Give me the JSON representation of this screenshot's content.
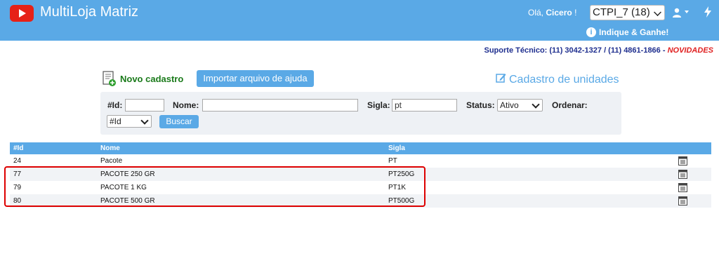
{
  "header": {
    "app_title": "MultiLoja Matriz",
    "greeting": "Olá,",
    "user_name": "Cicero",
    "greeting_suffix": "!",
    "store_select": "CTPI_7 (18)",
    "indique_label": "Indique & Ganhe!",
    "brand_color": "#5aa9e6",
    "logo_color": "#e62117"
  },
  "support": {
    "text": "Suporte Técnico: (11) 3042-1327 / (11) 4861-1866 -",
    "novidades": "NOVIDADES"
  },
  "actions": {
    "novo_cadastro": "Novo cadastro",
    "importar_label": "Importar arquivo de ajuda",
    "page_title": "Cadastro de unidades"
  },
  "filters": {
    "id_label": "#Id:",
    "id_value": "",
    "nome_label": "Nome:",
    "nome_value": "",
    "sigla_label": "Sigla:",
    "sigla_value": "pt",
    "status_label": "Status:",
    "status_value": "Ativo",
    "ordenar_label": "Ordenar:",
    "ordenar_value": "#Id",
    "buscar_label": "Buscar"
  },
  "table": {
    "columns": [
      "#Id",
      "Nome",
      "Sigla"
    ],
    "rows": [
      {
        "id": "24",
        "nome": "Pacote",
        "sigla": "PT"
      },
      {
        "id": "77",
        "nome": "PACOTE 250 GR",
        "sigla": "PT250G"
      },
      {
        "id": "79",
        "nome": "PACOTE 1 KG",
        "sigla": "PT1K"
      },
      {
        "id": "80",
        "nome": "PACOTE 500 GR",
        "sigla": "PT500G"
      }
    ],
    "highlight_color": "#dd0000"
  }
}
